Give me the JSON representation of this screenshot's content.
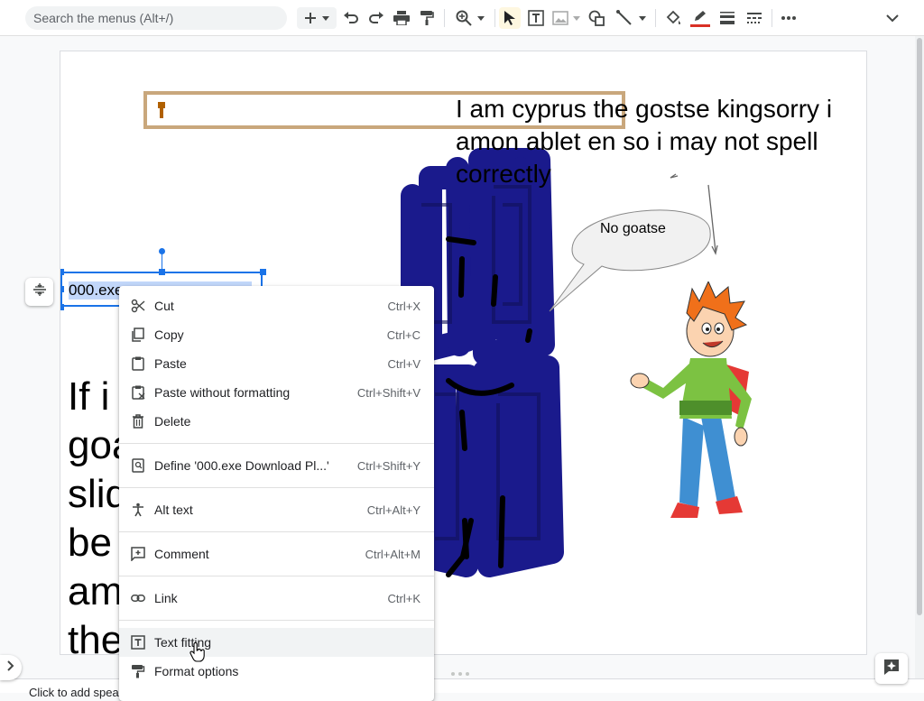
{
  "toolbar": {
    "search_placeholder": "Search the menus (Alt+/)",
    "buttons": [
      "new-slide",
      "undo",
      "redo",
      "print",
      "paint-format",
      "zoom",
      "select",
      "text-box",
      "image",
      "shape",
      "line",
      "fill-color",
      "border-color",
      "border-weight",
      "border-dash",
      "more",
      "collapse"
    ],
    "border_color_accent": "#d93025"
  },
  "slide": {
    "cyprus_text": "I am cyprus the gostse kingsorry i amon ablet en so i may not spell correctly",
    "bubble_text": "No goatse",
    "selected_text": "000.exe Download Pl...",
    "selected_text_visible": "000.exe",
    "big_text_lines": [
      "If i",
      "goa",
      "slid",
      "be",
      "am",
      "the"
    ],
    "notes_text": "Click to add speaker notes"
  },
  "context_menu": {
    "items": [
      {
        "label": "Cut",
        "shortcut": "Ctrl+X",
        "icon": "scissors-icon"
      },
      {
        "label": "Copy",
        "shortcut": "Ctrl+C",
        "icon": "copy-icon"
      },
      {
        "label": "Paste",
        "shortcut": "Ctrl+V",
        "icon": "clipboard-icon"
      },
      {
        "label": "Paste without formatting",
        "shortcut": "Ctrl+Shift+V",
        "icon": "clipboard-plain-icon"
      },
      {
        "label": "Delete",
        "shortcut": "",
        "icon": "trash-icon"
      },
      {
        "label": "Define '000.exe Download Pl...'",
        "shortcut": "Ctrl+Shift+Y",
        "icon": "dictionary-icon"
      },
      {
        "label": "Alt text",
        "shortcut": "Ctrl+Alt+Y",
        "icon": "accessibility-icon"
      },
      {
        "label": "Comment",
        "shortcut": "Ctrl+Alt+M",
        "icon": "comment-add-icon"
      },
      {
        "label": "Link",
        "shortcut": "Ctrl+K",
        "icon": "link-icon"
      },
      {
        "label": "Text fitting",
        "shortcut": "",
        "icon": "text-fitting-icon"
      },
      {
        "label": "Format options",
        "shortcut": "",
        "icon": "format-paint-icon"
      }
    ]
  },
  "colors": {
    "selection": "#1a73e8",
    "scribble": "#1a1a8c",
    "textbox_border": "#c9a77c"
  }
}
